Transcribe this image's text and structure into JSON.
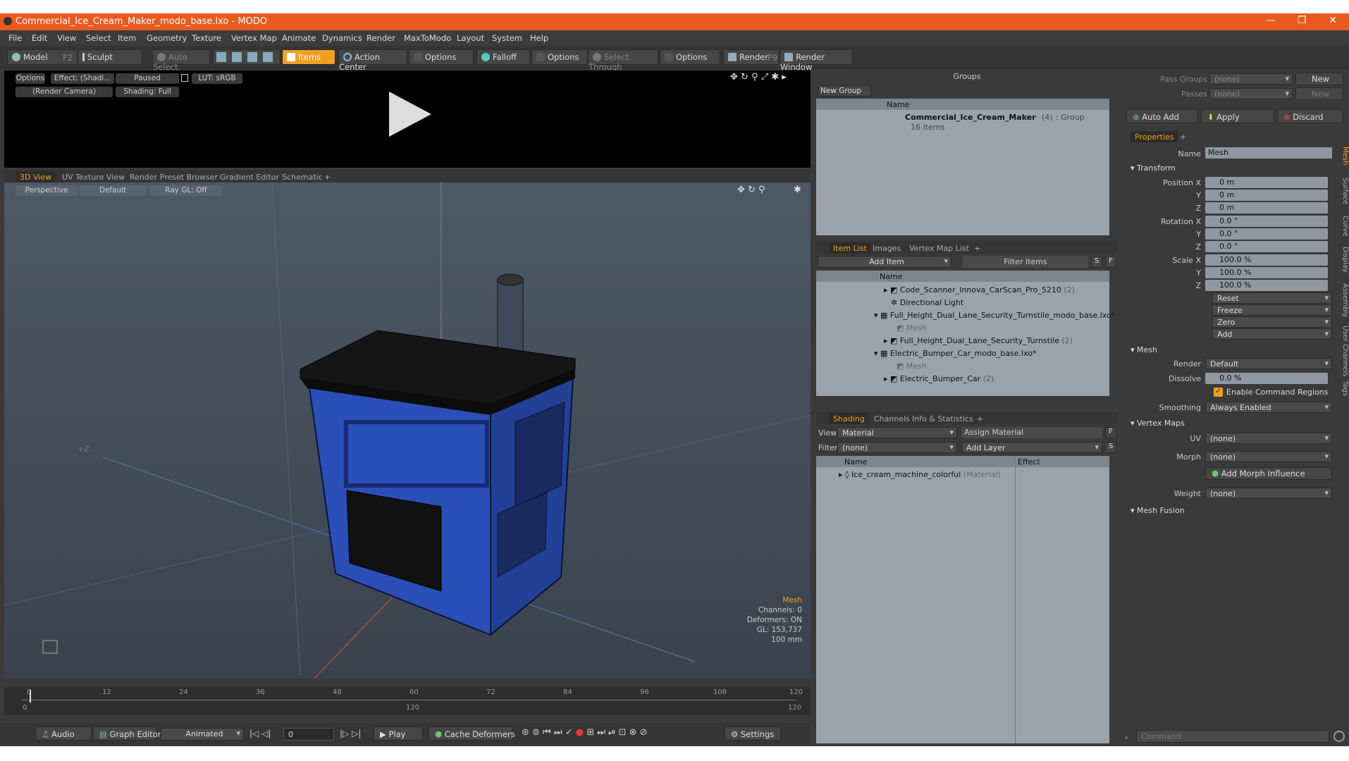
{
  "window": {
    "title": "Commercial_Ice_Cream_Maker_modo_base.lxo - MODO",
    "minimize": "—",
    "maximize": "❐",
    "close": "✕"
  },
  "menu": [
    "File",
    "Edit",
    "View",
    "Select",
    "Item",
    "Geometry",
    "Texture",
    "Vertex Map",
    "Animate",
    "Dynamics",
    "Render",
    "MaxToModo",
    "Layout",
    "System",
    "Help"
  ],
  "toolbar": {
    "model": "Model",
    "model_key": "F2",
    "sculpt": "Sculpt",
    "auto_select": "Auto Select",
    "items": "Items",
    "action_center": "Action Center",
    "options1": "Options",
    "falloff": "Falloff",
    "options2": "Options",
    "select_through": "Select Through",
    "options3": "Options",
    "render": "Render",
    "render_key": "F9",
    "render_window": "Render Window"
  },
  "preview": {
    "options": "Options",
    "effect": "Effect: (Shadi...",
    "paused": "Paused",
    "lut": "LUT: sRGB",
    "camera": "(Render Camera)",
    "shading": "Shading: Full"
  },
  "viewport_tabs": [
    "3D View",
    "UV Texture View",
    "Render Preset Browser",
    "Gradient Editor",
    "Schematic",
    "+"
  ],
  "viewport": {
    "perspective": "Perspective",
    "default": "Default",
    "raygl": "Ray GL: Off",
    "axis_label": "+Z",
    "info": {
      "type": "Mesh",
      "channels": "Channels: 0",
      "deformers": "Deformers: ON",
      "gl": "GL: 153,737",
      "size": "100 mm"
    }
  },
  "timeline": {
    "ticks": [
      "0",
      "12",
      "24",
      "36",
      "48",
      "60",
      "72",
      "84",
      "96",
      "108",
      "120"
    ],
    "sub": [
      "0",
      "120",
      "120"
    ]
  },
  "bottom": {
    "audio": "Audio",
    "graph_editor": "Graph Editor",
    "animated": "Animated",
    "frame": "0",
    "play": "Play",
    "cache": "Cache Deformers",
    "settings": "Settings"
  },
  "groups": {
    "title": "Groups",
    "new_group": "New Group",
    "col_name": "Name",
    "item_name": "Commercial_Ice_Cream_Maker",
    "item_count": "(4)",
    "item_type": ": Group",
    "item_sub": "16 Items"
  },
  "item_list": {
    "tabs": [
      "Item List",
      "Images",
      "Vertex Map List",
      "+"
    ],
    "add_item": "Add Item",
    "filter": "Filter Items",
    "s": "S",
    "f": "F",
    "col_name": "Name",
    "rows": [
      {
        "label": "Code_Scanner_Innova_CarScan_Pro_5210",
        "extra": "(2)"
      },
      {
        "label": "Directional Light",
        "extra": ""
      },
      {
        "label": "Full_Height_Dual_Lane_Security_Turnstile_modo_base.lxo*",
        "extra": ""
      },
      {
        "label": "Mesh",
        "extra": ""
      },
      {
        "label": "Full_Height_Dual_Lane_Security_Turnstile",
        "extra": "(2)"
      },
      {
        "label": "Electric_Bumper_Car_modo_base.lxo*",
        "extra": ""
      },
      {
        "label": "Mesh",
        "extra": ""
      },
      {
        "label": "Electric_Bumper_Car",
        "extra": "(2)"
      }
    ]
  },
  "shading": {
    "tabs": [
      "Shading",
      "Channels",
      "Info & Statistics",
      "+"
    ],
    "view_label": "View",
    "view_value": "Material",
    "assign": "Assign Material",
    "f": "F",
    "filter_label": "Filter",
    "filter_value": "(none)",
    "add_layer": "Add Layer",
    "s": "S",
    "col_name": "Name",
    "col_effect": "Effect",
    "row_name": "Ice_cream_machine_colorful",
    "row_type": "(Material)"
  },
  "props": {
    "pass_groups_label": "Pass Groups",
    "pass_groups_value": "(none)",
    "new1": "New",
    "passes_label": "Passes",
    "passes_value": "(none)",
    "new2": "New",
    "auto_add": "Auto Add",
    "apply": "Apply",
    "discard": "Discard",
    "tab": "Properties",
    "plus": "+",
    "name_label": "Name",
    "name_value": "Mesh",
    "transform": "Transform",
    "pos_x_label": "Position X",
    "pos_x": "0 m",
    "pos_y": "0 m",
    "pos_z": "0 m",
    "rot_x_label": "Rotation X",
    "rot_x": "0.0 °",
    "rot_y": "0.0 °",
    "rot_z": "0.0 °",
    "scale_x_label": "Scale X",
    "scale_x": "100.0 %",
    "scale_y": "100.0 %",
    "scale_z": "100.0 %",
    "y": "Y",
    "z": "Z",
    "reset": "Reset",
    "freeze": "Freeze",
    "zero": "Zero",
    "add": "Add",
    "mesh_section": "Mesh",
    "render_label": "Render",
    "render_value": "Default",
    "dissolve_label": "Dissolve",
    "dissolve_value": "0.0 %",
    "enable_cmd": "Enable Command Regions",
    "smoothing_label": "Smoothing",
    "smoothing_value": "Always Enabled",
    "vmaps": "Vertex Maps",
    "uv_label": "UV",
    "uv_value": "(none)",
    "morph_label": "Morph",
    "morph_value": "(none)",
    "add_morph": "Add Morph Influence",
    "weight_label": "Weight",
    "weight_value": "(none)",
    "mesh_fusion": "Mesh Fusion",
    "command_placeholder": "Command"
  },
  "side_tabs": [
    "Mesh",
    "Surface",
    "Curve",
    "Display",
    "Assembly",
    "User Channels",
    "Tags"
  ],
  "colors": {
    "accent": "#f0a020",
    "titlebar": "#ea5a1f",
    "model_blue": "#2a4fb8"
  }
}
